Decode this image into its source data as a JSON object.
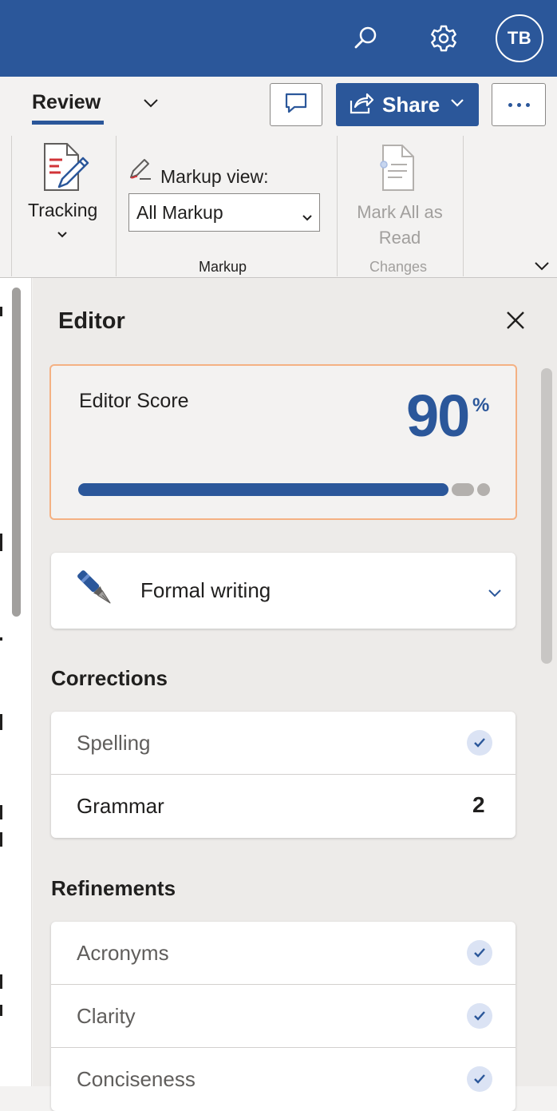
{
  "header": {
    "search_icon": "search-icon",
    "settings_icon": "gear-icon",
    "avatar_initials": "TB",
    "brand_color": "#2b579a"
  },
  "ribbon": {
    "active_tab": "Review",
    "comment_icon": "comment-icon",
    "share_label": "Share",
    "more_icon": "more-icon",
    "tracking_label": "Tracking",
    "markup_view_label": "Markup view:",
    "markup_view_value": "All Markup",
    "markup_group": "Markup",
    "mark_all_read_line1": "Mark All as",
    "mark_all_read_line2": "Read",
    "changes_group": "Changes"
  },
  "editor": {
    "title": "Editor",
    "close_icon": "close-icon",
    "score_label": "Editor Score",
    "score_value": "90",
    "score_unit": "%",
    "score_fraction": 0.9,
    "writing_style": "Formal writing",
    "corrections_title": "Corrections",
    "corrections": [
      {
        "label": "Spelling",
        "status": "done"
      },
      {
        "label": "Grammar",
        "count": "2"
      }
    ],
    "refinements_title": "Refinements",
    "refinements": [
      {
        "label": "Acronyms",
        "status": "done"
      },
      {
        "label": "Clarity",
        "status": "done"
      },
      {
        "label": "Conciseness",
        "status": "done"
      }
    ]
  }
}
